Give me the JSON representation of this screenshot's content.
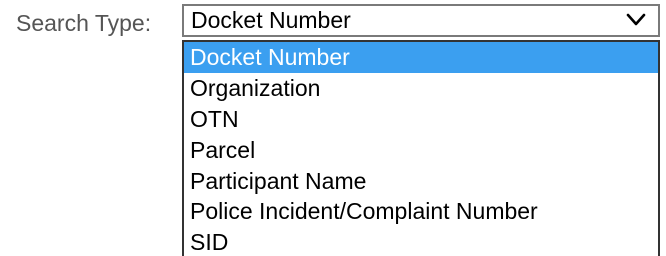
{
  "search": {
    "label": "Search Type:",
    "selected_value": "Docket Number",
    "chevron_icon": "chevron-down-icon",
    "options": [
      {
        "label": "Docket Number",
        "selected": true
      },
      {
        "label": "Organization",
        "selected": false
      },
      {
        "label": "OTN",
        "selected": false
      },
      {
        "label": "Parcel",
        "selected": false
      },
      {
        "label": "Participant Name",
        "selected": false
      },
      {
        "label": "Police Incident/Complaint Number",
        "selected": false
      },
      {
        "label": "SID",
        "selected": false
      }
    ]
  },
  "colors": {
    "highlight": "#3b9ff0",
    "highlight_text": "#ffffff",
    "label_text": "#555555"
  }
}
